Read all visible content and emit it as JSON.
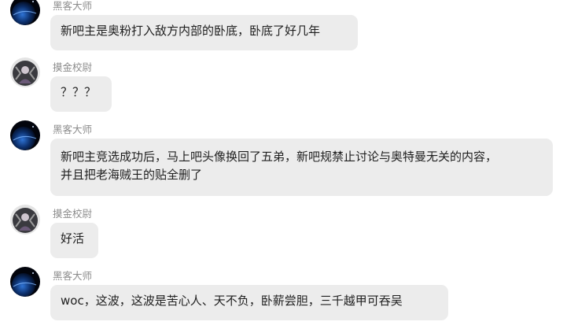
{
  "messages": [
    {
      "sender": "黑客大师",
      "avatar_icon": "planet-avatar-icon",
      "lines": [
        "新吧主是奥粉打入敌方内部的卧底，卧底了好几年"
      ]
    },
    {
      "sender": "摸金校尉",
      "avatar_icon": "character-avatar-icon",
      "lines": [
        "？？？"
      ]
    },
    {
      "sender": "黑客大师",
      "avatar_icon": "planet-avatar-icon",
      "lines": [
        "新吧主竞选成功后，马上吧头像换回了五弟，新吧规禁止讨论与奥特曼无关的内容，",
        "并且把老海贼王的贴全删了"
      ]
    },
    {
      "sender": "摸金校尉",
      "avatar_icon": "character-avatar-icon",
      "lines": [
        "好活"
      ]
    },
    {
      "sender": "黑客大师",
      "avatar_icon": "planet-avatar-icon",
      "lines": [
        "woc，这波，这波是苦心人、天不负，卧薪尝胆，三千越甲可吞吴"
      ]
    }
  ]
}
